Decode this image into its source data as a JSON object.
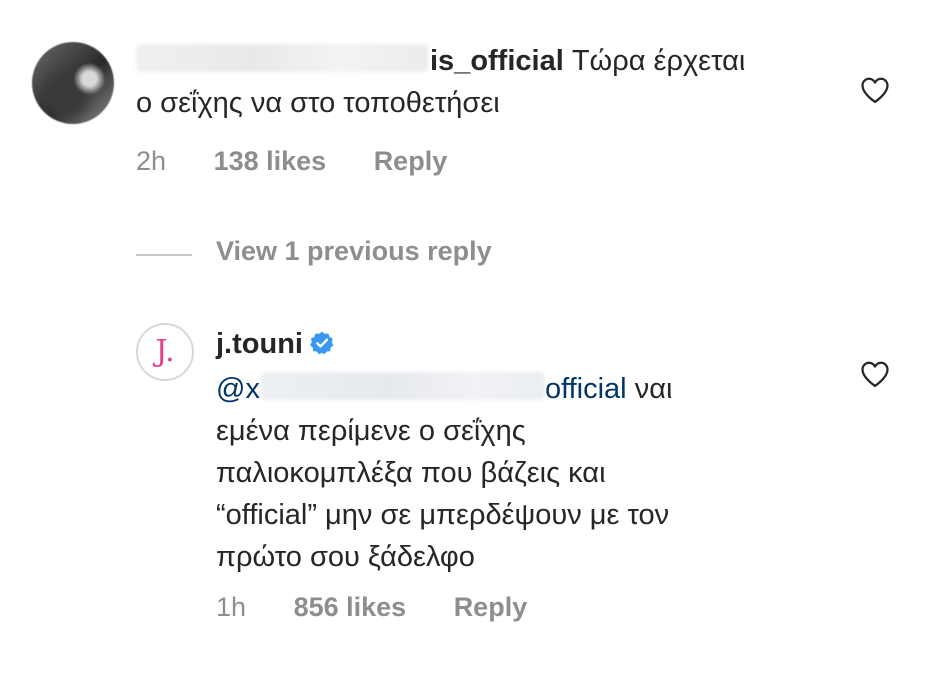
{
  "comment": {
    "username_visible": "is_official",
    "text_line1": "Τώρα έρχεται",
    "text_line2": "ο σεΐχης να στο τοποθετήσει",
    "time": "2h",
    "likes": "138 likes",
    "reply_label": "Reply"
  },
  "thread": {
    "view_previous": "View 1 previous reply"
  },
  "reply": {
    "avatar_letter": "J.",
    "username": "j.touni",
    "mention_prefix": "@x",
    "mention_visible": "official",
    "text_first": "ναι",
    "text_line2": "εμένα περίμενε ο σεΐχης",
    "text_line3": "παλιοκομπλέξα που βάζεις και",
    "text_line4": "“official” μην σε μπερδέψουν με τον",
    "text_line5": "πρώτο σου ξάδελφο",
    "time": "1h",
    "likes": "856 likes",
    "reply_label": "Reply"
  },
  "icons": {
    "like": "heart-outline-icon",
    "verified": "verified-badge-icon"
  },
  "colors": {
    "text": "#262626",
    "secondary": "#8e8e8e",
    "mention": "#003569",
    "verified": "#3897f0",
    "avatar_letter": "#e33f8c"
  }
}
